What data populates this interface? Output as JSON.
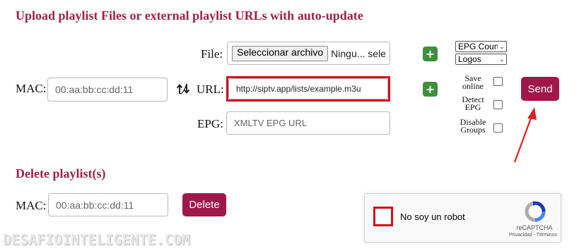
{
  "upload_section": {
    "title": "Upload playlist Files or external playlist URLs with auto-update",
    "mac_label": "MAC:",
    "mac_placeholder": "00:aa:bb:cc:dd:11",
    "file_label": "File:",
    "file_button": "Seleccionar archivo",
    "file_status": "Ningu... selec.",
    "url_label": "URL:",
    "url_value": "http://siptv.app/lists/example.m3u",
    "epg_label": "EPG:",
    "epg_placeholder": "XMLTV EPG URL",
    "epg_country_select": "EPG Coun",
    "logos_select": "Logos",
    "options": {
      "save_online": "Save online",
      "detect_epg": "Detect EPG",
      "disable_groups": "Disable Groups"
    },
    "send_button": "Send",
    "swap_icon": "swap-arrows-icon",
    "add_icon": "+"
  },
  "delete_section": {
    "title": "Delete playlist(s)",
    "mac_label": "MAC:",
    "mac_placeholder": "00:aa:bb:cc:dd:11",
    "delete_button": "Delete"
  },
  "recaptcha": {
    "label": "No soy un robot",
    "brand": "reCAPTCHA",
    "links": "Privacidad - Términos"
  },
  "watermark": "DESAFIOINTELIGENTE.COM",
  "colors": {
    "accent": "#9b2346",
    "button": "#a0184a",
    "plus_button": "#3f8f3f",
    "highlight": "#d0101c"
  }
}
